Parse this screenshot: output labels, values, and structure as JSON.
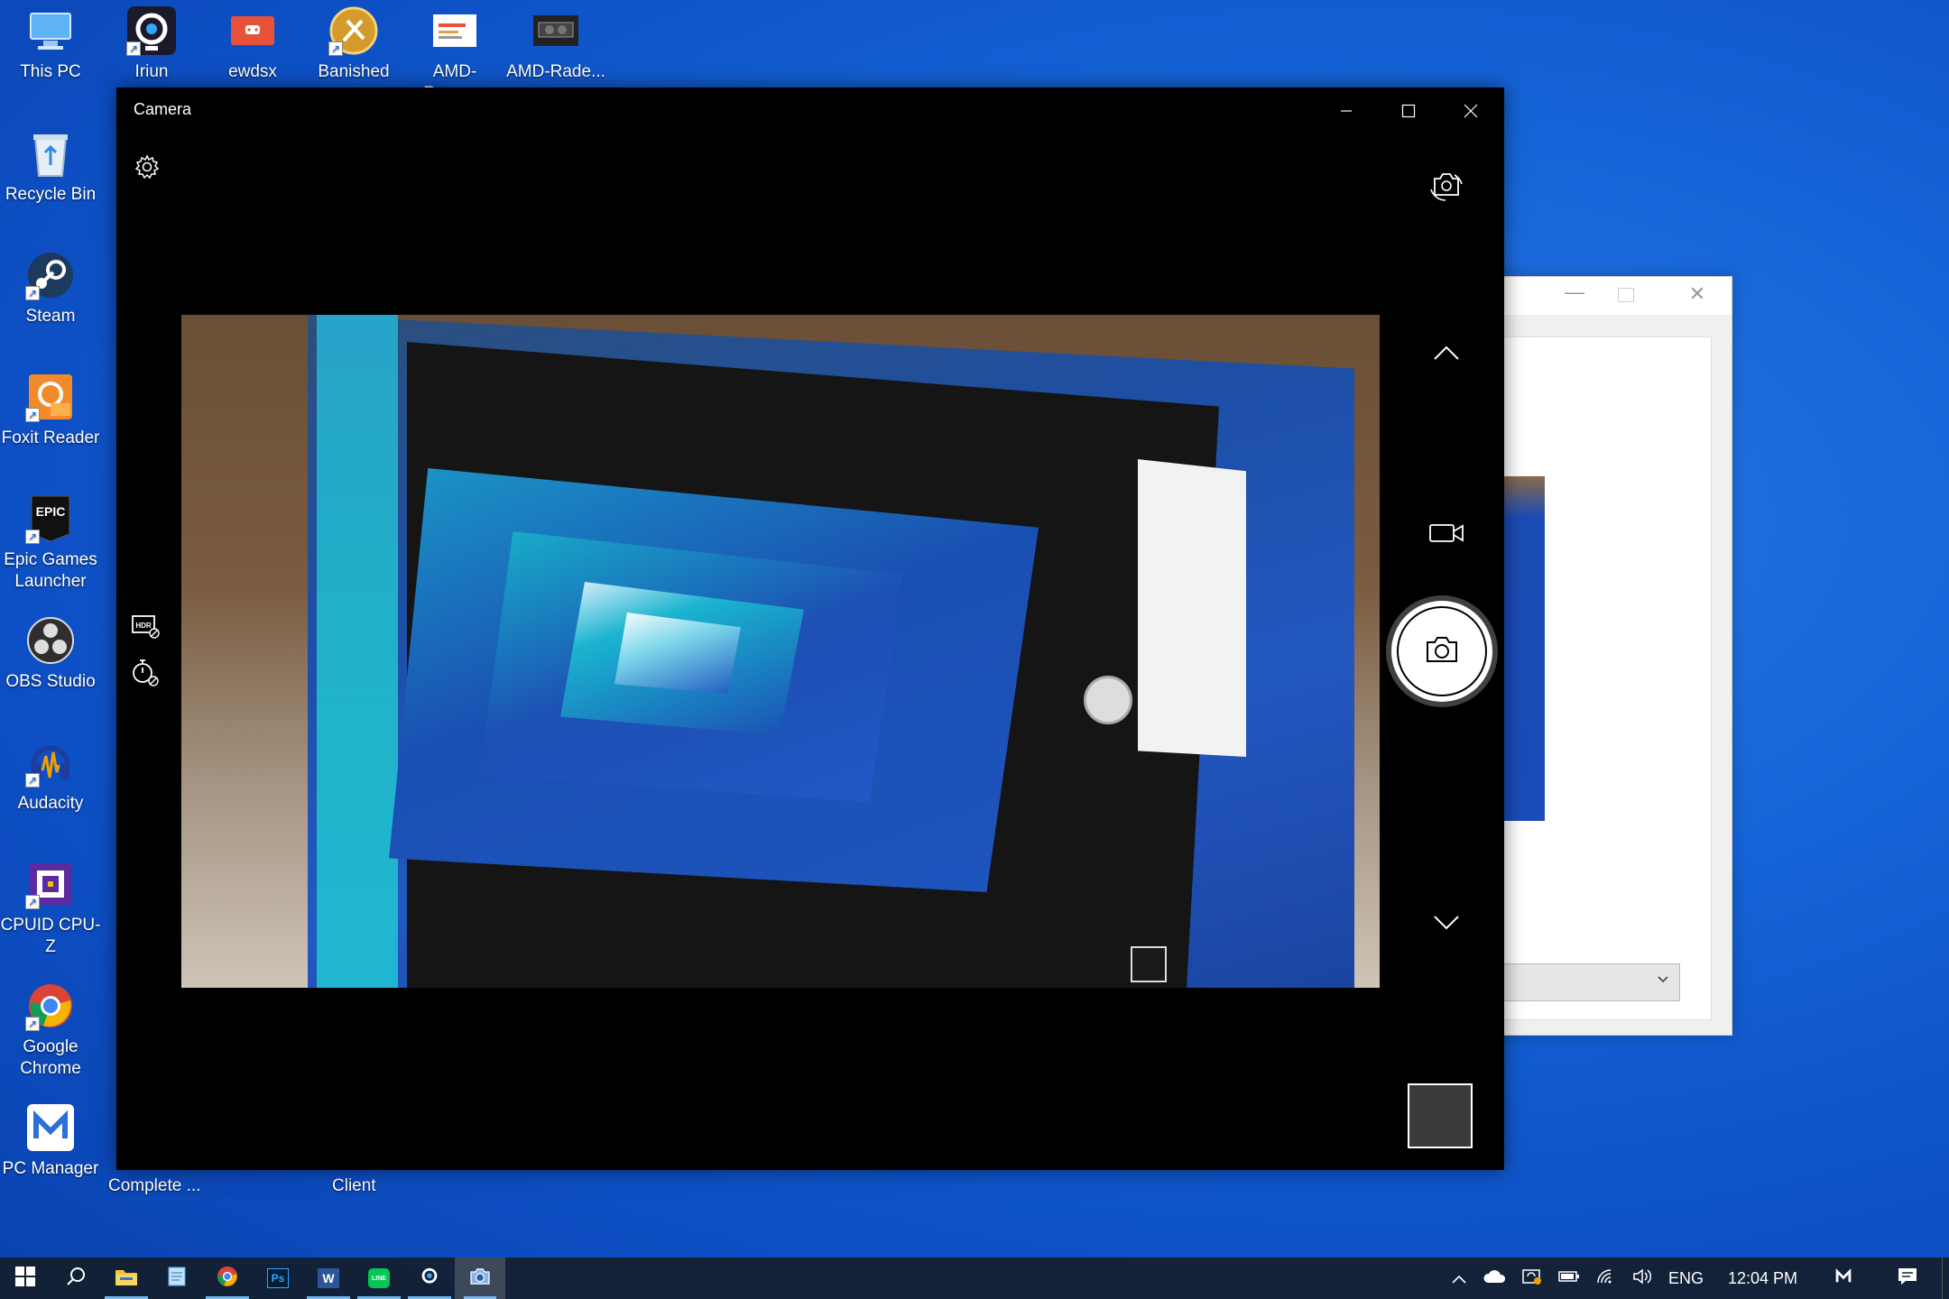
{
  "desktop": {
    "icons_top": [
      {
        "label": "This PC",
        "icon": "this-pc-icon"
      },
      {
        "label": "Iriun",
        "icon": "iriun-icon"
      },
      {
        "label": "ewdsx",
        "icon": "ewdsx-icon"
      },
      {
        "label": "Banished",
        "icon": "banished-icon"
      },
      {
        "label": "AMD-Ryzen...",
        "icon": "amd-ryzen-icon"
      },
      {
        "label": "AMD-Rade...",
        "icon": "amd-radeon-icon"
      }
    ],
    "icons_left": [
      {
        "label": "Recycle Bin",
        "icon": "recycle-bin-icon"
      },
      {
        "label": "Steam",
        "icon": "steam-icon"
      },
      {
        "label": "Foxit Reader",
        "icon": "foxit-reader-icon"
      },
      {
        "label": "Epic Games\nLauncher",
        "icon": "epic-games-icon"
      },
      {
        "label": "OBS Studio",
        "icon": "obs-studio-icon"
      },
      {
        "label": "Audacity",
        "icon": "audacity-icon"
      },
      {
        "label": "CPUID CPU-Z",
        "icon": "cpu-z-icon"
      },
      {
        "label": "Google\nChrome",
        "icon": "chrome-icon"
      },
      {
        "label": "PC Manager",
        "icon": "pc-manager-icon"
      }
    ],
    "hidden_labels": [
      "Complete ...",
      "Client"
    ]
  },
  "camera_window": {
    "title": "Camera",
    "minimize_glyph": "—",
    "close_glyph": "✕"
  },
  "background_window": {
    "minimize_glyph": "—",
    "close_glyph": "✕"
  },
  "taskbar": {
    "apps": [
      "start-icon",
      "search-icon",
      "file-explorer-icon",
      "notepad-icon",
      "chrome-icon",
      "photoshop-icon",
      "word-icon",
      "line-icon",
      "iriun-icon",
      "camera-icon"
    ],
    "photoshop_label": "Ps",
    "word_label": "W",
    "line_label": "LINE",
    "language": "ENG",
    "time": "12:04 PM"
  },
  "colors": {
    "desktop_blue": "#1565d8",
    "taskbar": "#142030",
    "accent": "#76b9ed"
  }
}
